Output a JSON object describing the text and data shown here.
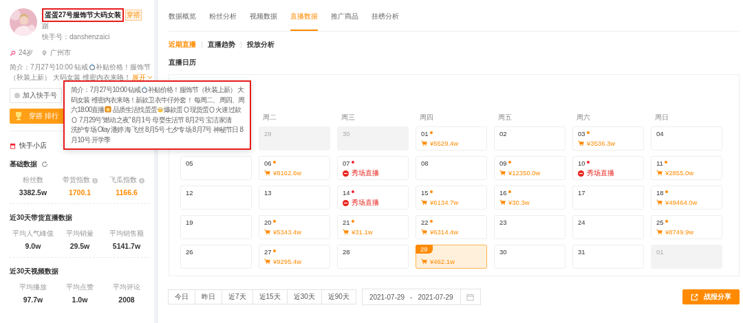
{
  "profile": {
    "name": "蛋蛋27号服饰节大码女装",
    "tag": "穿搭",
    "name_rest": "踞",
    "account": "快手号：danshenzaici",
    "age": "24岁",
    "city": "广州市",
    "intro": [
      [
        {
          "kind": "text",
          "text": "简介：7月27号10:00 钻戒"
        },
        {
          "kind": "ring"
        },
        {
          "kind": "text",
          "text": "补贴价格！服饰节"
        }
      ],
      [
        {
          "kind": "text",
          "text": "（秋装上新） 大码女装 维密内衣来咯！"
        }
      ]
    ],
    "expand": "展开",
    "add_button": "加入快手号",
    "banner": "穿搭 排行",
    "shop": "快手小店"
  },
  "tooltip": [
    [
      {
        "kind": "text",
        "text": "简介：7月27号10:00 钻戒"
      },
      {
        "kind": "ring"
      },
      {
        "kind": "text",
        "text": "补贴价格！服饰节（秋装上新） 大"
      }
    ],
    [
      {
        "kind": "text",
        "text": "码女装 维密内衣来咯！新款卫衣牛仔外套！ 每周二、周四、周"
      }
    ],
    [
      {
        "kind": "text",
        "text": "六18:00直播"
      },
      {
        "kind": "lion"
      },
      {
        "kind": "text",
        "text": " 品质生活找蛋蛋"
      },
      {
        "kind": "chick"
      },
      {
        "kind": "text",
        "text": "爆款蛋"
      },
      {
        "kind": "egg"
      },
      {
        "kind": "text",
        "text": "现货蛋"
      },
      {
        "kind": "egg"
      },
      {
        "kind": "text",
        "text": "火速过款"
      }
    ],
    [
      {
        "kind": "egg"
      },
      {
        "kind": "text",
        "text": " 7月29号“燃动之夜” 8月1号 母婴生活节 8月2号 宝洁家清"
      }
    ],
    [
      {
        "kind": "text",
        "text": "洗护专场 Olay 潘婷 海飞丝 8月5号 七夕专场 8月7号 神秘节日 8"
      }
    ],
    [
      {
        "kind": "text",
        "text": "月10号 开学季"
      }
    ]
  ],
  "sections": [
    {
      "title": "基础数据",
      "refresh": true,
      "stats": [
        {
          "label": "粉丝数",
          "value": "3382.5w",
          "info": false,
          "highlight": false
        },
        {
          "label": "带货指数",
          "value": "1700.1",
          "info": true,
          "highlight": true
        },
        {
          "label": "飞瓜指数",
          "value": "1166.6",
          "info": true,
          "highlight": true
        }
      ]
    },
    {
      "title": "近30天带货直播数据",
      "refresh": false,
      "stats": [
        {
          "label": "平均人气峰值",
          "value": "9.0w",
          "info": false,
          "highlight": false
        },
        {
          "label": "平均销量",
          "value": "29.5w",
          "info": false,
          "highlight": false
        },
        {
          "label": "平均销售额",
          "value": "5141.7w",
          "info": false,
          "highlight": false
        }
      ]
    },
    {
      "title": "近30天视频数据",
      "refresh": false,
      "stats": [
        {
          "label": "平均播放",
          "value": "97.7w",
          "info": false,
          "highlight": false
        },
        {
          "label": "平均点赞",
          "value": "1.0w",
          "info": false,
          "highlight": false
        },
        {
          "label": "平均评论",
          "value": "2008",
          "info": false,
          "highlight": false
        }
      ]
    }
  ],
  "tabs": [
    {
      "label": "数据概览",
      "selected": false
    },
    {
      "label": "粉丝分析",
      "selected": false
    },
    {
      "label": "视频数据",
      "selected": false
    },
    {
      "label": "直播数据",
      "selected": true
    },
    {
      "label": "推广商品",
      "selected": false
    },
    {
      "label": "挂榜分析",
      "selected": false
    }
  ],
  "subtabs": [
    {
      "label": "近期直播",
      "selected": true
    },
    {
      "label": "直播趋势",
      "selected": false
    },
    {
      "label": "投放分析",
      "selected": false
    }
  ],
  "calendar_title": "直播日历",
  "weekdays": [
    "周二",
    "周三",
    "周四",
    "周五",
    "周六",
    "周日"
  ],
  "weeks": [
    [
      {
        "day": "29",
        "muted": true,
        "selected": false
      },
      {
        "day": "30",
        "muted": true,
        "selected": false
      },
      {
        "day": "01",
        "muted": false,
        "selected": false,
        "kind": "sales",
        "amount": "¥5529.4w",
        "color": "#ff8a00"
      },
      {
        "day": "02",
        "muted": false,
        "selected": false
      },
      {
        "day": "03",
        "muted": false,
        "selected": false,
        "kind": "sales",
        "amount": "¥3536.3w",
        "color": "#ff8a00"
      },
      {
        "day": "04",
        "muted": false,
        "selected": false
      }
    ],
    [
      {
        "day": "05",
        "muted": false,
        "selected": false
      },
      {
        "day": "06",
        "muted": false,
        "selected": false,
        "kind": "sales",
        "amount": "¥8162.6w",
        "color": "#ff8a00"
      },
      {
        "day": "07",
        "muted": false,
        "selected": false,
        "kind": "show",
        "amount": "秀场直播",
        "color": "#f5222d"
      },
      {
        "day": "08",
        "muted": false,
        "selected": false
      },
      {
        "day": "09",
        "muted": false,
        "selected": false,
        "kind": "sales",
        "amount": "¥12350.0w",
        "color": "#ff8a00"
      },
      {
        "day": "10",
        "muted": false,
        "selected": false,
        "kind": "show",
        "amount": "秀场直播",
        "color": "#f5222d"
      },
      {
        "day": "11",
        "muted": false,
        "selected": false,
        "kind": "sales",
        "amount": "¥2855.0w",
        "color": "#ff8a00"
      }
    ],
    [
      {
        "day": "12",
        "muted": false,
        "selected": false
      },
      {
        "day": "13",
        "muted": false,
        "selected": false
      },
      {
        "day": "14",
        "muted": false,
        "selected": false,
        "kind": "show",
        "amount": "秀场直播",
        "color": "#f5222d"
      },
      {
        "day": "15",
        "muted": false,
        "selected": false,
        "kind": "sales",
        "amount": "¥6134.7w",
        "color": "#ff8a00"
      },
      {
        "day": "16",
        "muted": false,
        "selected": false,
        "kind": "sales",
        "amount": "¥30.3w",
        "color": "#ff8a00"
      },
      {
        "day": "17",
        "muted": false,
        "selected": false
      },
      {
        "day": "18",
        "muted": false,
        "selected": false,
        "kind": "sales",
        "amount": "¥49464.0w",
        "color": "#ff8a00"
      }
    ],
    [
      {
        "day": "19",
        "muted": false,
        "selected": false
      },
      {
        "day": "20",
        "muted": false,
        "selected": false,
        "kind": "sales",
        "amount": "¥5343.4w",
        "color": "#ff8a00"
      },
      {
        "day": "21",
        "muted": false,
        "selected": false,
        "kind": "sales",
        "amount": "¥31.1w",
        "color": "#ff8a00"
      },
      {
        "day": "22",
        "muted": false,
        "selected": false,
        "kind": "sales",
        "amount": "¥6314.4w",
        "color": "#ff8a00"
      },
      {
        "day": "23",
        "muted": false,
        "selected": false
      },
      {
        "day": "24",
        "muted": false,
        "selected": false
      },
      {
        "day": "25",
        "muted": false,
        "selected": false,
        "kind": "sales",
        "amount": "¥8749.9w",
        "color": "#ff8a00"
      }
    ],
    [
      {
        "day": "26",
        "muted": false,
        "selected": false
      },
      {
        "day": "27",
        "muted": false,
        "selected": false,
        "kind": "sales",
        "amount": "¥9295.4w",
        "color": "#ff8a00"
      },
      {
        "day": "28",
        "muted": false,
        "selected": false
      },
      {
        "day": "29",
        "muted": false,
        "selected": true,
        "kind": "sales",
        "amount": "¥462.1w"
      },
      {
        "day": "30",
        "muted": false,
        "selected": false
      },
      {
        "day": "31",
        "muted": false,
        "selected": false
      },
      {
        "day": "01",
        "muted": true,
        "selected": false
      }
    ]
  ],
  "ranges": [
    "今日",
    "昨日",
    "近7天",
    "近15天",
    "近30天",
    "近90天"
  ],
  "date_from": "2021-07-29",
  "date_sep": "-",
  "date_to": "2021-07-29",
  "share": "战报分享"
}
